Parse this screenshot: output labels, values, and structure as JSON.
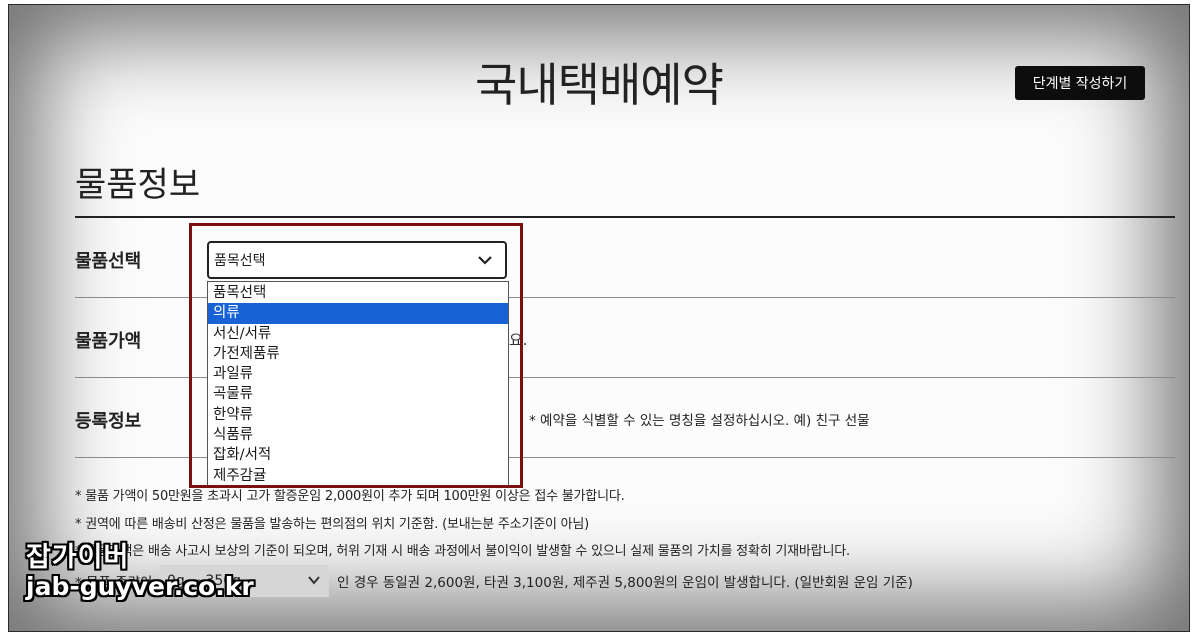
{
  "header": {
    "title": "국내택배예약",
    "guide_button": "단계별 작성하기"
  },
  "section": {
    "title": "물품정보"
  },
  "rows": {
    "item_select_label": "물품선택",
    "item_value_label": "물품가액",
    "registration_label": "등록정보"
  },
  "item_select": {
    "selected": "품목선택",
    "options": [
      "품목선택",
      "의류",
      "서신/서류",
      "가전제품류",
      "과일류",
      "곡물류",
      "한약류",
      "식품류",
      "잡화/서적",
      "제주감귤"
    ],
    "highlighted_index": 1
  },
  "item_value_partial": "요.",
  "registration_note": "* 예약을 식별할 수 있는 명칭을 설정하십시오. 예) 친구 선물",
  "notes": [
    "* 물품 가액이 50만원을 초과시 고가 할증운임 2,000원이 추가 되며 100만원 이상은 접수 불가합니다.",
    "* 권역에 따른 배송비 산정은 물품을 발송하는 편의점의 위치 기준함. (보내는분 주소기준이 아님)",
    "* 물품가액은 배송 사고시 보상의 기준이 되오며, 허위 기재 시 배송 과정에서 불이익이 발생할 수 있으니 실제 물품의 가치를 정확히 기재바랍니다."
  ],
  "weight_prefix": "* 물품 중량이",
  "weight_select": "0g ~ 350g",
  "rate_text": "인 경우  동일권 2,600원, 타권 3,100원, 제주권 5,800원의 운임이 발생합니다. (일반회원 운임 기준)",
  "watermark": {
    "line1": "잡가이버",
    "line2": "jab-guyver.co.kr"
  }
}
